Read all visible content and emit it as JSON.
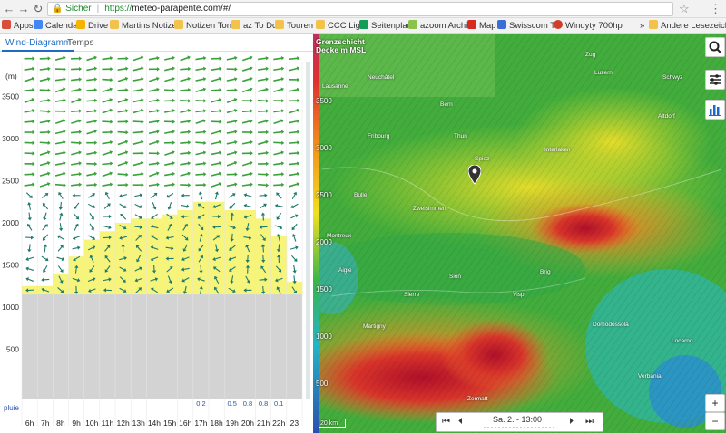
{
  "browser": {
    "secure_label": "Sicher",
    "url_scheme": "https://",
    "url_rest": "meteo-parapente.com/#/"
  },
  "bookmarks": [
    {
      "label": "Apps",
      "icon": "apps-grid-icon",
      "color": "#d94e3a"
    },
    {
      "label": "Calendar",
      "icon": "calendar-icon",
      "color": "#4285f4"
    },
    {
      "label": "Drive",
      "icon": "drive-icon",
      "color": "#f4b400"
    },
    {
      "label": "Martins Notizen",
      "icon": "folder-icon",
      "color": "#f3c24b"
    },
    {
      "label": "Notizen Toni",
      "icon": "folder-icon",
      "color": "#f3c24b"
    },
    {
      "label": "az To Do",
      "icon": "folder-icon",
      "color": "#f3c24b"
    },
    {
      "label": "Touren",
      "icon": "folder-icon",
      "color": "#f3c24b"
    },
    {
      "label": "CCC Liga",
      "icon": "folder-icon",
      "color": "#f3c24b"
    },
    {
      "label": "Seitenplan",
      "icon": "sheet-icon",
      "color": "#0f9d58"
    },
    {
      "label": "azoom Archiv",
      "icon": "azoom-icon",
      "color": "#8bc34a"
    },
    {
      "label": "Map",
      "icon": "swiss-flag-icon",
      "color": "#d52b1e"
    },
    {
      "label": "Swisscom TV",
      "icon": "swisscom-icon",
      "color": "#3b6fd8"
    },
    {
      "label": "Windyty 700hp",
      "icon": "windyty-icon",
      "color": "#d13c2b"
    }
  ],
  "bookmarks_more": "»",
  "bookmarks_other": "Andere Lesezeichen",
  "tabs": {
    "wind": "Wind-Diagramm",
    "temps": "Temps"
  },
  "diagram": {
    "unit": "(m)",
    "altitudes": [
      "3500",
      "3000",
      "2500",
      "2000",
      "1500",
      "1000",
      "500"
    ],
    "hours": [
      "6h",
      "7h",
      "8h",
      "9h",
      "10h",
      "11h",
      "12h",
      "13h",
      "14h",
      "15h",
      "16h",
      "17h",
      "18h",
      "19h",
      "20h",
      "21h",
      "22h",
      "23"
    ],
    "rain_label": "pluie",
    "rain_values": [
      "",
      "",
      "",
      "",
      "",
      "",
      "",
      "",
      "",
      "",
      "",
      "0.2",
      "",
      "0.5",
      "0.8",
      "0.8",
      "0.1",
      ""
    ],
    "colors": {
      "thermal": "#f6f47a",
      "ground": "#d3d3d3",
      "arrow_strong": "#3aa23a",
      "arrow_weak": "#1f7a6e"
    }
  },
  "map": {
    "legend_title": "Grenzschicht Decke m MSL",
    "legend_values": [
      "3500",
      "3000",
      "2500",
      "2000",
      "1500",
      "1000",
      "500"
    ],
    "places": [
      "Neuchâtel",
      "Bern",
      "Thun",
      "Spiez",
      "Interlaken",
      "Fribourg",
      "Bulle",
      "Zweisimmen",
      "Sion",
      "Martigny",
      "Zermatt",
      "Brig",
      "Visp",
      "Luzern",
      "Zug",
      "Schwyz",
      "Altdorf",
      "Domodossola",
      "Verbania",
      "Locarno",
      "Montreux",
      "Aigle",
      "Lausanne",
      "Sierre"
    ],
    "time_label": "Sa. 2. - 13:00",
    "scale_label": "20 km",
    "zoom_in": "+",
    "zoom_out": "−"
  }
}
